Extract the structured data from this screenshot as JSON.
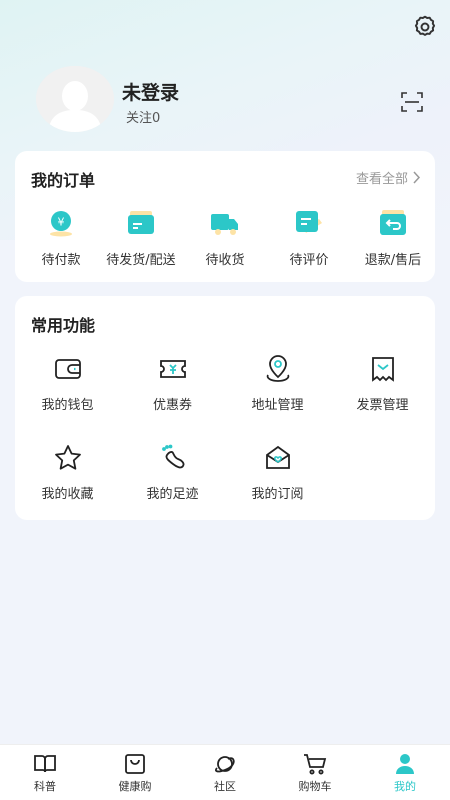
{
  "colors": {
    "accent": "#2cc7c8",
    "card_bg": "#ffffff",
    "page_bg": "#f1f4fb"
  },
  "header": {
    "user_name": "未登录",
    "follow_text": "关注0",
    "settings_icon": "gear-icon",
    "scan_icon": "scan-icon"
  },
  "orders": {
    "title": "我的订单",
    "view_all": "查看全部",
    "items": [
      {
        "label": "待付款",
        "icon": "payment-pending-icon"
      },
      {
        "label": "待发货/配送",
        "icon": "wallet-card-icon"
      },
      {
        "label": "待收货",
        "icon": "truck-icon"
      },
      {
        "label": "待评价",
        "icon": "review-edit-icon"
      },
      {
        "label": "退款/售后",
        "icon": "refund-icon"
      }
    ]
  },
  "functions": {
    "title": "常用功能",
    "items": [
      {
        "label": "我的钱包",
        "icon": "wallet-icon"
      },
      {
        "label": "优惠券",
        "icon": "coupon-icon"
      },
      {
        "label": "地址管理",
        "icon": "location-pin-icon"
      },
      {
        "label": "发票管理",
        "icon": "invoice-icon"
      },
      {
        "label": "我的收藏",
        "icon": "star-icon"
      },
      {
        "label": "我的足迹",
        "icon": "footprint-icon"
      },
      {
        "label": "我的订阅",
        "icon": "subscription-mail-icon"
      }
    ]
  },
  "tabbar": {
    "active": "我的",
    "items": [
      {
        "label": "科普",
        "icon": "book-icon"
      },
      {
        "label": "健康购",
        "icon": "shopping-bag-icon"
      },
      {
        "label": "社区",
        "icon": "planet-icon"
      },
      {
        "label": "购物车",
        "icon": "cart-icon"
      },
      {
        "label": "我的",
        "icon": "person-icon"
      }
    ]
  }
}
